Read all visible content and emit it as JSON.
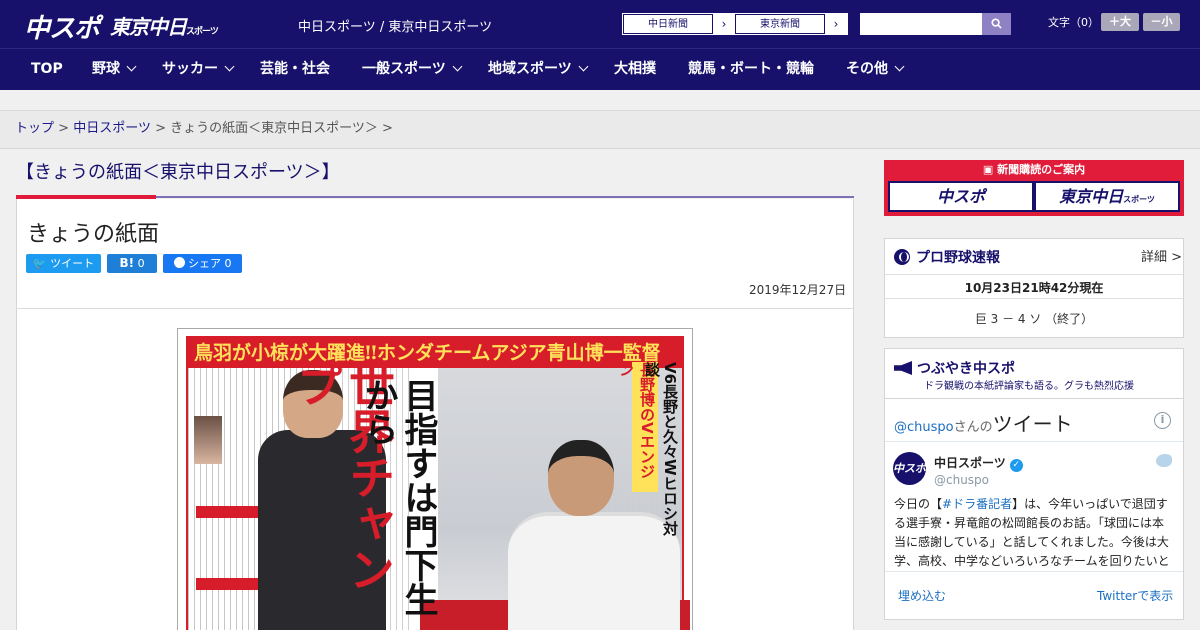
{
  "header": {
    "logo_primary": "中スポ",
    "logo_secondary": "東京中日",
    "logo_secondary_small": "スポーツ",
    "tagline": "中日スポーツ / 東京中日スポーツ",
    "ext_links": [
      {
        "label": "中日新聞",
        "arrow": "›"
      },
      {
        "label": "東京新聞",
        "arrow": "›"
      }
    ],
    "search_placeholder": "",
    "search_icon": "search-icon",
    "font_label": "文字（0）",
    "font_larger": "＋大",
    "font_smaller": "－小"
  },
  "nav": {
    "items": [
      {
        "label": "TOP"
      },
      {
        "label": "野球"
      },
      {
        "label": "サッカー"
      },
      {
        "label": "芸能・社会"
      },
      {
        "label": "一般スポーツ"
      },
      {
        "label": "地域スポーツ"
      },
      {
        "label": "大相撲"
      },
      {
        "label": "競馬・ボート・競輪"
      },
      {
        "label": "その他"
      }
    ]
  },
  "breadcrumb": {
    "items": [
      "トップ",
      "中日スポーツ"
    ],
    "separator": ">",
    "current": "きょうの紙面＜東京中日スポーツ＞"
  },
  "article": {
    "section_title": "【きょうの紙面＜東京中日スポーツ＞】",
    "title": "きょうの紙面",
    "share": {
      "tweet": "ツイート",
      "hatena": "B!",
      "hatena_count": "0",
      "facebook": "シェア",
      "facebook_count": "0"
    },
    "date": "2019年12月27日",
    "paper": {
      "headline": "鳥羽が小椋が大躍進‼ホンダチームアジア青山博一監督",
      "big_title": "世界チャンプ",
      "subtitle": "目指すは門下生から",
      "side_note": "V6長野と久々Wヒロシ対談",
      "side_red": "長野博のVエンジン"
    }
  },
  "sidebar": {
    "subscribe": {
      "caption": "新聞購読のご案内",
      "logo_a": "中スポ",
      "logo_b": "東京中日",
      "logo_b_small": "スポーツ"
    },
    "baseball": {
      "title": "プロ野球速報",
      "detail": "詳細 >",
      "time": "10月23日21時42分現在",
      "score": "巨 3 － 4 ソ （終了）"
    },
    "tsubuyaki": {
      "title": "つぶやき中スポ",
      "subtitle": "ドラ観戦の本紙評論家も語る。グラも熱烈応援"
    },
    "twitter": {
      "handle_link": "@chuspo",
      "handle_suffix": "さんの",
      "heading": "ツイート",
      "user_name": "中日スポーツ",
      "user_handle": "@chuspo",
      "avatar_text": "中スポ",
      "tweet_prefix": "今日の【",
      "tweet_tag": "#ドラ番記者",
      "tweet_rest": "】は、今年いっぱいで退団する選手寮・昇竜館の松岡館長のお話。「球団には本当に感謝している」と話してくれました。今後は大学、高校、中学などいろいろなチームを回りたいと",
      "embed": "埋め込む",
      "view_on": "Twitterで表示"
    }
  }
}
